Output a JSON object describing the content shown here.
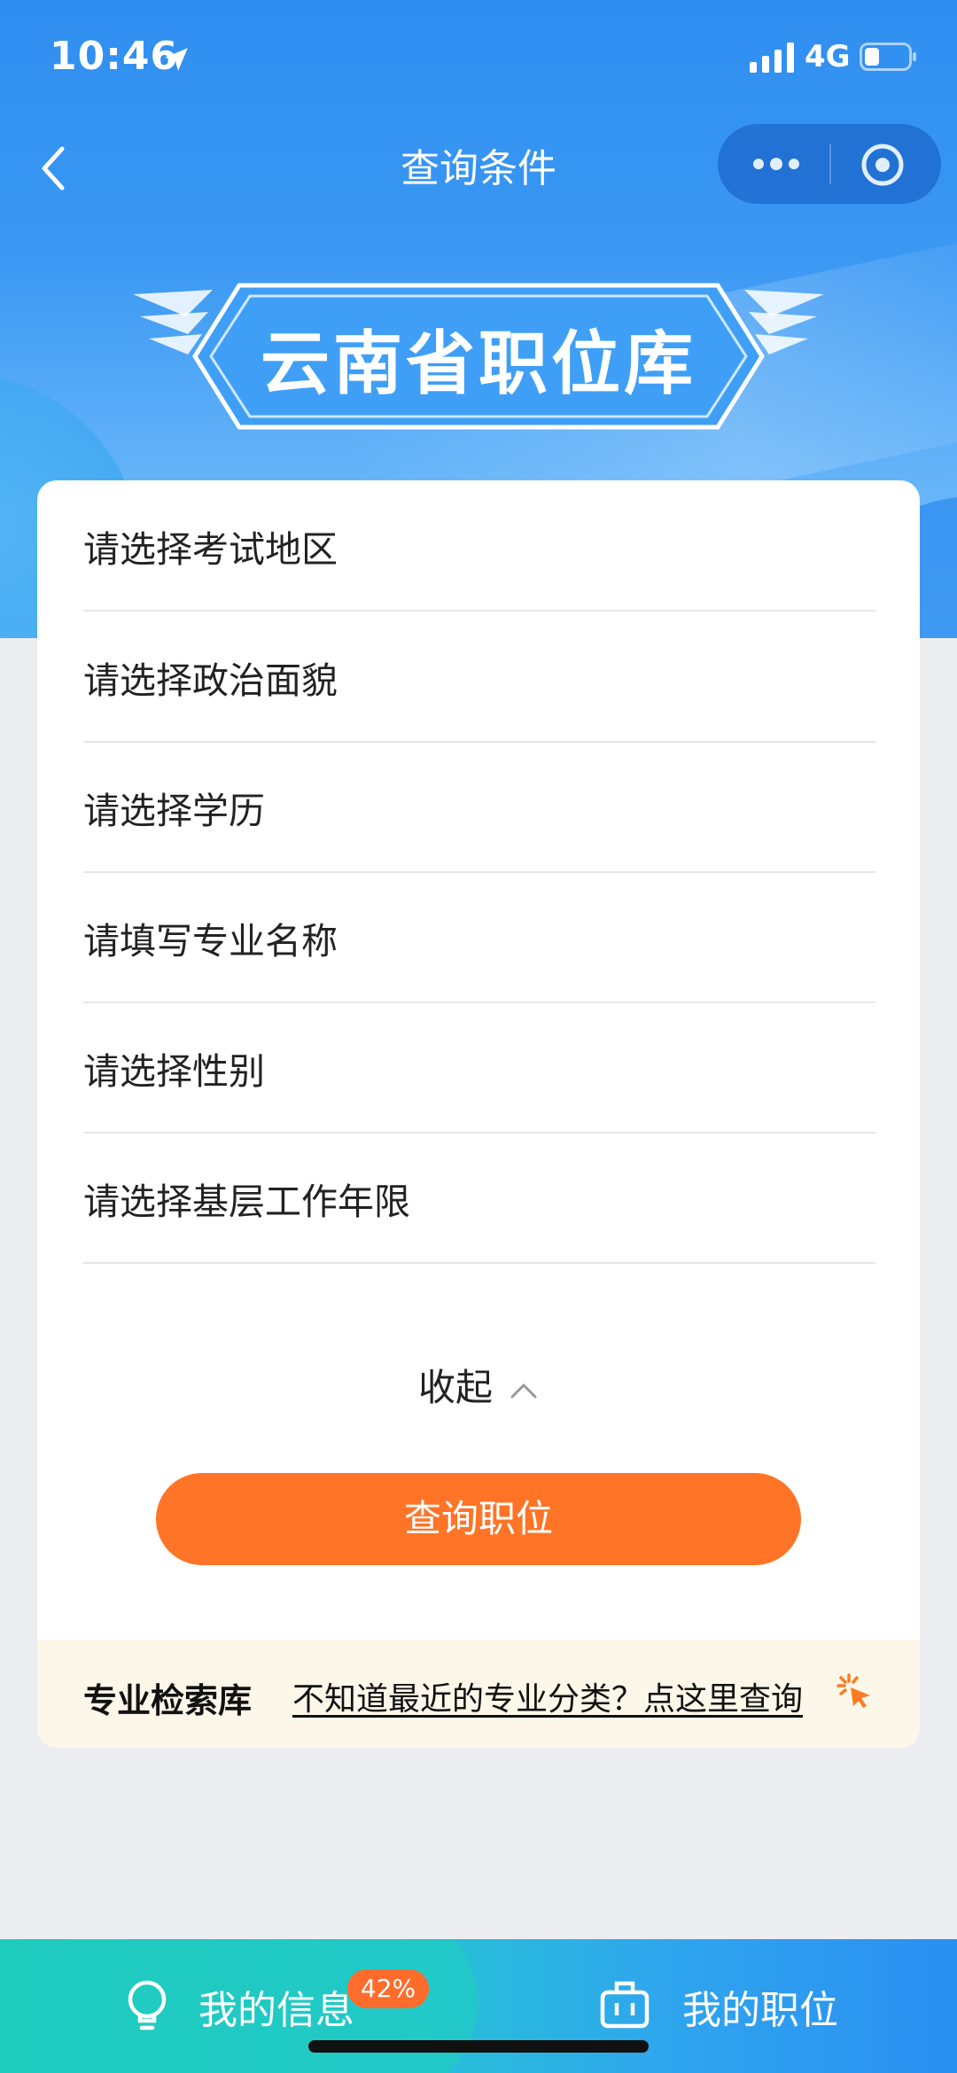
{
  "status_bar": {
    "time": "10:46",
    "network": "4G"
  },
  "nav": {
    "title": "查询条件"
  },
  "banner": {
    "title": "云南省职位库"
  },
  "form": {
    "fields": [
      {
        "placeholder": "请选择考试地区"
      },
      {
        "placeholder": "请选择政治面貌"
      },
      {
        "placeholder": "请选择学历"
      },
      {
        "placeholder": "请填写专业名称"
      },
      {
        "placeholder": "请选择性别"
      },
      {
        "placeholder": "请选择基层工作年限"
      }
    ],
    "collapse_label": "收起",
    "submit_label": "查询职位"
  },
  "tip": {
    "label": "专业检索库",
    "link": "不知道最近的专业分类？点这里查询"
  },
  "tabbar": {
    "info_label": "我的信息",
    "info_badge": "42%",
    "jobs_label": "我的职位"
  },
  "colors": {
    "primary_blue": "#2f8ef0",
    "accent_orange": "#ff7426",
    "tip_bg": "#fdf7e9",
    "page_bg": "#ebedf1"
  },
  "icons": [
    "location-arrow-icon",
    "signal-icon",
    "battery-icon",
    "back-arrow-icon",
    "more-dots-icon",
    "target-icon",
    "chevron-up-icon",
    "sparkle-cursor-icon",
    "lightbulb-icon",
    "briefcase-icon"
  ]
}
